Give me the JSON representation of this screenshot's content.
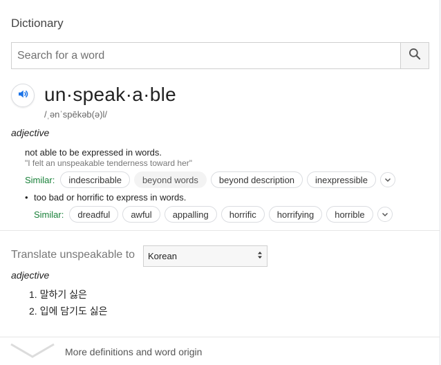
{
  "card": {
    "title": "Dictionary",
    "search": {
      "placeholder": "Search for a word",
      "value": ""
    },
    "entry": {
      "word": "un·speak·a·ble",
      "phonetic": "/ˌənˈspēkəb(ə)l/",
      "part_of_speech": "adjective",
      "senses": [
        {
          "definition": "not able to be expressed in words.",
          "example": "\"I felt an unspeakable tenderness toward her\"",
          "similar_label": "Similar:",
          "similar": [
            "indescribable",
            "beyond words",
            "beyond description",
            "inexpressible"
          ]
        },
        {
          "bullet": "•",
          "definition": "too bad or horrific to express in words.",
          "similar_label": "Similar:",
          "similar": [
            "dreadful",
            "awful",
            "appalling",
            "horrific",
            "horrifying",
            "horrible"
          ]
        }
      ]
    },
    "translate": {
      "label": "Translate unspeakable to",
      "language": "Korean",
      "part_of_speech": "adjective",
      "items": [
        "1. 말하기 싫은",
        "2. 입에 담기도 싫은"
      ]
    },
    "more": {
      "label": "More definitions and word origin"
    }
  },
  "icons": {
    "search": "search-icon",
    "speaker": "speaker-icon",
    "expand": "chevron-down-icon",
    "select_arrows": "updown-arrows-icon",
    "more_chevron": "chevron-down-icon"
  },
  "colors": {
    "accent_blue": "#1a73e8",
    "similar_green": "#188038",
    "text": "#222222",
    "muted": "#777777"
  }
}
